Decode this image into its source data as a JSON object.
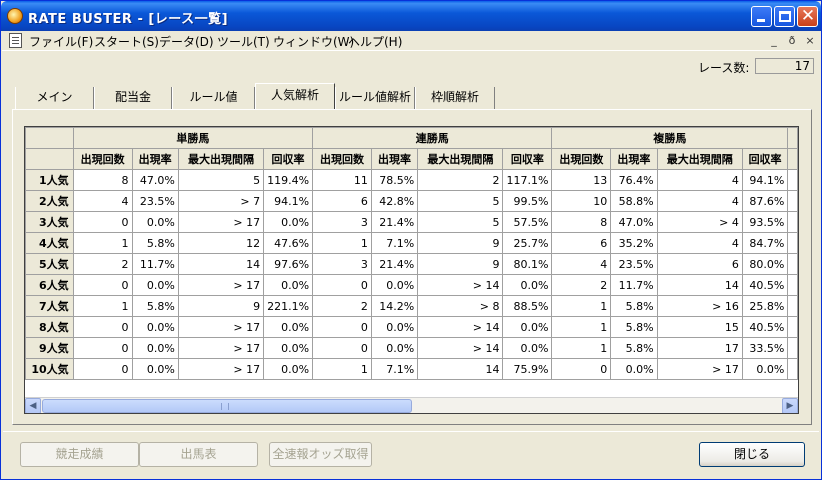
{
  "window": {
    "title": "RATE BUSTER - [レース一覧]"
  },
  "menu": [
    "ファイル(F)",
    "スタート(S)",
    "データ(D)",
    "ツール(T)",
    "ウィンドウ(W)",
    "ヘルプ(H)"
  ],
  "mdi_controls": [
    "_",
    "ð",
    "×"
  ],
  "race_count": {
    "label": "レース数:",
    "value": "17"
  },
  "tabs": [
    "メイン",
    "配当金",
    "ルール値",
    "人気解析",
    "ルール値解析",
    "枠順解析"
  ],
  "active_tab": "人気解析",
  "grid": {
    "groups": [
      "単勝馬",
      "連勝馬",
      "複勝馬"
    ],
    "subheaders": [
      "出現回数",
      "出現率",
      "最大出現間隔",
      "回収率",
      "出現回数",
      "出現率",
      "最大出現間隔",
      "回収率",
      "出現回数",
      "出現率",
      "最大出現間隔",
      "回収率"
    ],
    "rows": [
      {
        "label": "1人気",
        "cells": [
          "8",
          "47.0%",
          "5",
          "119.4%",
          "11",
          "78.5%",
          "2",
          "117.1%",
          "13",
          "76.4%",
          "4",
          "94.1%"
        ]
      },
      {
        "label": "2人気",
        "cells": [
          "4",
          "23.5%",
          "> 7",
          "94.1%",
          "6",
          "42.8%",
          "5",
          "99.5%",
          "10",
          "58.8%",
          "4",
          "87.6%"
        ]
      },
      {
        "label": "3人気",
        "cells": [
          "0",
          "0.0%",
          "> 17",
          "0.0%",
          "3",
          "21.4%",
          "5",
          "57.5%",
          "8",
          "47.0%",
          "> 4",
          "93.5%"
        ]
      },
      {
        "label": "4人気",
        "cells": [
          "1",
          "5.8%",
          "12",
          "47.6%",
          "1",
          "7.1%",
          "9",
          "25.7%",
          "6",
          "35.2%",
          "4",
          "84.7%"
        ]
      },
      {
        "label": "5人気",
        "cells": [
          "2",
          "11.7%",
          "14",
          "97.6%",
          "3",
          "21.4%",
          "9",
          "80.1%",
          "4",
          "23.5%",
          "6",
          "80.0%"
        ]
      },
      {
        "label": "6人気",
        "cells": [
          "0",
          "0.0%",
          "> 17",
          "0.0%",
          "0",
          "0.0%",
          "> 14",
          "0.0%",
          "2",
          "11.7%",
          "14",
          "40.5%"
        ]
      },
      {
        "label": "7人気",
        "cells": [
          "1",
          "5.8%",
          "9",
          "221.1%",
          "2",
          "14.2%",
          "> 8",
          "88.5%",
          "1",
          "5.8%",
          "> 16",
          "25.8%"
        ]
      },
      {
        "label": "8人気",
        "cells": [
          "0",
          "0.0%",
          "> 17",
          "0.0%",
          "0",
          "0.0%",
          "> 14",
          "0.0%",
          "1",
          "5.8%",
          "15",
          "40.5%"
        ]
      },
      {
        "label": "9人気",
        "cells": [
          "0",
          "0.0%",
          "> 17",
          "0.0%",
          "0",
          "0.0%",
          "> 14",
          "0.0%",
          "1",
          "5.8%",
          "17",
          "33.5%"
        ]
      },
      {
        "label": "10人気",
        "cells": [
          "0",
          "0.0%",
          "> 17",
          "0.0%",
          "1",
          "7.1%",
          "14",
          "75.9%",
          "0",
          "0.0%",
          "> 17",
          "0.0%"
        ]
      }
    ]
  },
  "buttons": {
    "race_results": "競走成績",
    "race_card": "出馬表",
    "fetch_odds": "全速報オッズ取得",
    "close": "閉じる"
  }
}
